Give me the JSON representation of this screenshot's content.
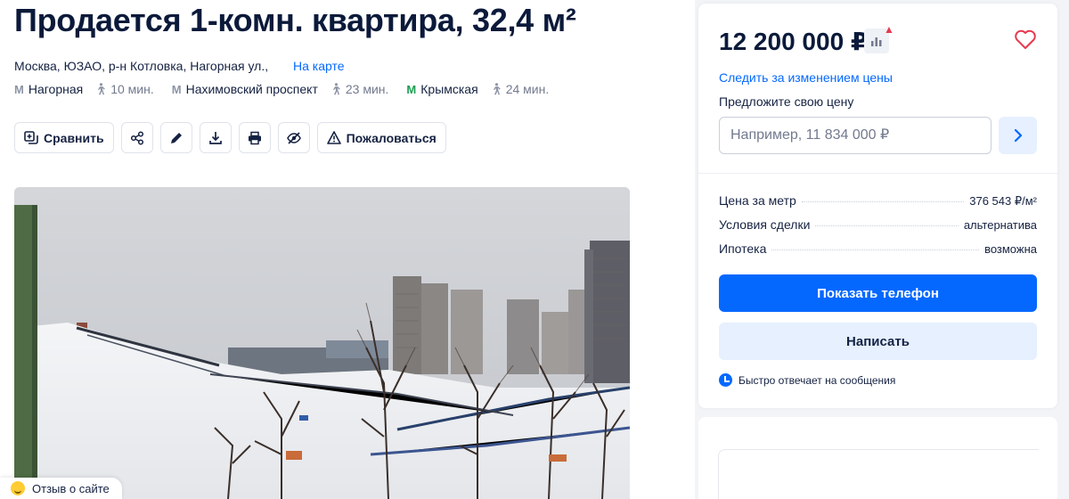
{
  "listing": {
    "title": "Продается 1-комн. квартира, 32,4 м²",
    "address": "Москва, ЮЗАО, р-н Котловка, Нагорная ул.,",
    "map_link": "На карте",
    "metro": [
      {
        "name": "Нагорная",
        "walk": "10 мин.",
        "line_color": "#8d94a5"
      },
      {
        "name": "Нахимовский проспект",
        "walk": "23 мин.",
        "line_color": "#8d94a5"
      },
      {
        "name": "Крымская",
        "walk": "24 мин.",
        "line_color": "#1a9e52"
      }
    ],
    "metro_icon": "М"
  },
  "toolbar": {
    "compare_label": "Сравнить",
    "complain_label": "Пожаловаться",
    "icons": [
      "compare-icon",
      "share-icon",
      "edit-icon",
      "download-icon",
      "print-icon",
      "hide-icon",
      "warning-icon"
    ]
  },
  "feedback": {
    "label": "Отзыв о сайте"
  },
  "sidebar": {
    "price": "12 200 000 ₽",
    "follow_price": "Следить за изменением цены",
    "offer_label": "Предложите свою цену",
    "offer_placeholder": "Например, 11 834 000 ₽",
    "facts": [
      {
        "key": "Цена за метр",
        "value": "376 543 ₽/м²"
      },
      {
        "key": "Условия сделки",
        "value": "альтернатива"
      },
      {
        "key": "Ипотека",
        "value": "возможна"
      }
    ],
    "show_phone": "Показать телефон",
    "write": "Написать",
    "fast_reply": "Быстро отвечает на сообщения"
  },
  "colors": {
    "accent": "#0468ff",
    "accent_light": "#e6f0ff",
    "text": "#152242",
    "favorite": "#e8384f"
  }
}
